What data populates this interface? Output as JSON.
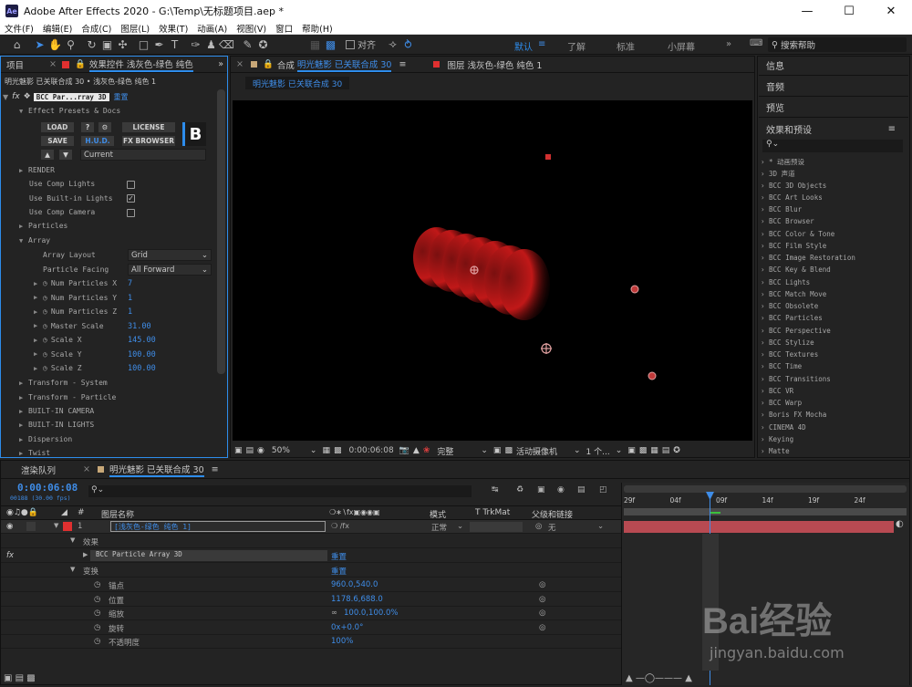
{
  "app": {
    "title": "Adobe After Effects 2020 - G:\\Temp\\无标题项目.aep *",
    "logo": "Ae"
  },
  "menu": [
    "文件(F)",
    "编辑(E)",
    "合成(C)",
    "图层(L)",
    "效果(T)",
    "动画(A)",
    "视图(V)",
    "窗口",
    "帮助(H)"
  ],
  "toolbar": {
    "align_label": "对齐",
    "workspaces": [
      "默认",
      "了解",
      "标准",
      "小屏幕"
    ],
    "search_placeholder": "搜索帮助"
  },
  "left_panel": {
    "tab_project": "项目",
    "tab_effects": "效果控件 浅灰色-绿色 纯色",
    "breadcrumb": "明光魅影 已关联合成 30 • 浅灰色-绿色 纯色 1",
    "effect_name": "BCC Par...rray 3D",
    "reset": "重置",
    "presets_label": "Effect Presets & Docs",
    "buttons": {
      "load": "LOAD",
      "help": "?",
      "license": "LICENSE",
      "save": "SAVE",
      "hud": "H.U.D.",
      "browser": "FX BROWSER",
      "current": "Current",
      "logo": "B"
    },
    "render": "RENDER",
    "checks": [
      {
        "label": "Use Comp Lights",
        "checked": false
      },
      {
        "label": "Use Built-in Lights",
        "checked": true
      },
      {
        "label": "Use Comp Camera",
        "checked": false
      }
    ],
    "particles": "Particles",
    "array": "Array",
    "array_layout": {
      "label": "Array Layout",
      "value": "Grid"
    },
    "particle_facing": {
      "label": "Particle Facing",
      "value": "All Forward"
    },
    "params": [
      {
        "label": "Num Particles X",
        "value": "7"
      },
      {
        "label": "Num Particles Y",
        "value": "1"
      },
      {
        "label": "Num Particles Z",
        "value": "1"
      },
      {
        "label": "Master Scale",
        "value": "31.00"
      },
      {
        "label": "Scale X",
        "value": "145.00"
      },
      {
        "label": "Scale Y",
        "value": "100.00"
      },
      {
        "label": "Scale Z",
        "value": "100.00"
      }
    ],
    "groups": [
      "Transform - System",
      "Transform - Particle",
      "BUILT-IN CAMERA",
      "BUILT-IN LIGHTS",
      "Dispersion",
      "Twist"
    ]
  },
  "comp_panel": {
    "tab_comp_prefix": "合成",
    "tab_comp_name": "明光魅影 已关联合成 30",
    "tab_layer": "图层 浅灰色-绿色 纯色 1",
    "subtab": "明光魅影 已关联合成 30",
    "bottom": {
      "zoom": "50%",
      "timecode": "0:00:06:08",
      "quality": "完整",
      "camera": "活动摄像机",
      "views": "1 个..."
    }
  },
  "right_panel": {
    "panels": [
      "信息",
      "音频",
      "预览"
    ],
    "effects_title": "效果和预设",
    "list": [
      "* 动画预设",
      "3D 声道",
      "BCC 3D Objects",
      "BCC Art Looks",
      "BCC Blur",
      "BCC Browser",
      "BCC Color & Tone",
      "BCC Film Style",
      "BCC Image Restoration",
      "BCC Key & Blend",
      "BCC Lights",
      "BCC Match Move",
      "BCC Obsolete",
      "BCC Particles",
      "BCC Perspective",
      "BCC Stylize",
      "BCC Textures",
      "BCC Time",
      "BCC Transitions",
      "BCC VR",
      "BCC Warp",
      "Boris FX Mocha",
      "CINEMA 4D",
      "Keying",
      "Matte"
    ]
  },
  "timeline": {
    "tab_render": "渲染队列",
    "tab_comp": "明光魅影 已关联合成 30",
    "timecode": "0:00:06:08",
    "fps": "00188 (30.00 fps)",
    "col_layer_name": "图层名称",
    "col_mode": "模式",
    "col_trkmat": "T TrkMat",
    "col_parent": "父级和链接",
    "layer": {
      "num": "1",
      "name": "[浅灰色-绿色 纯色 1]",
      "mode": "正常",
      "parent": "无"
    },
    "effects_group": "效果",
    "effect_item": "BCC Particle Array 3D",
    "effect_reset": "重置",
    "transform": "变换",
    "transform_reset": "重置",
    "props": [
      {
        "label": "锚点",
        "value": "960.0,540.0"
      },
      {
        "label": "位置",
        "value": "1178.6,688.0"
      },
      {
        "label": "缩放",
        "value": "100.0,100.0%"
      },
      {
        "label": "旋转",
        "value": "0x+0.0°"
      },
      {
        "label": "不透明度",
        "value": "100%"
      }
    ],
    "ruler": [
      "29f",
      "04f",
      "09f",
      "14f",
      "19f",
      "24f"
    ]
  },
  "watermark": {
    "text": "Bai经验",
    "url": "jingyan.baidu.com"
  }
}
